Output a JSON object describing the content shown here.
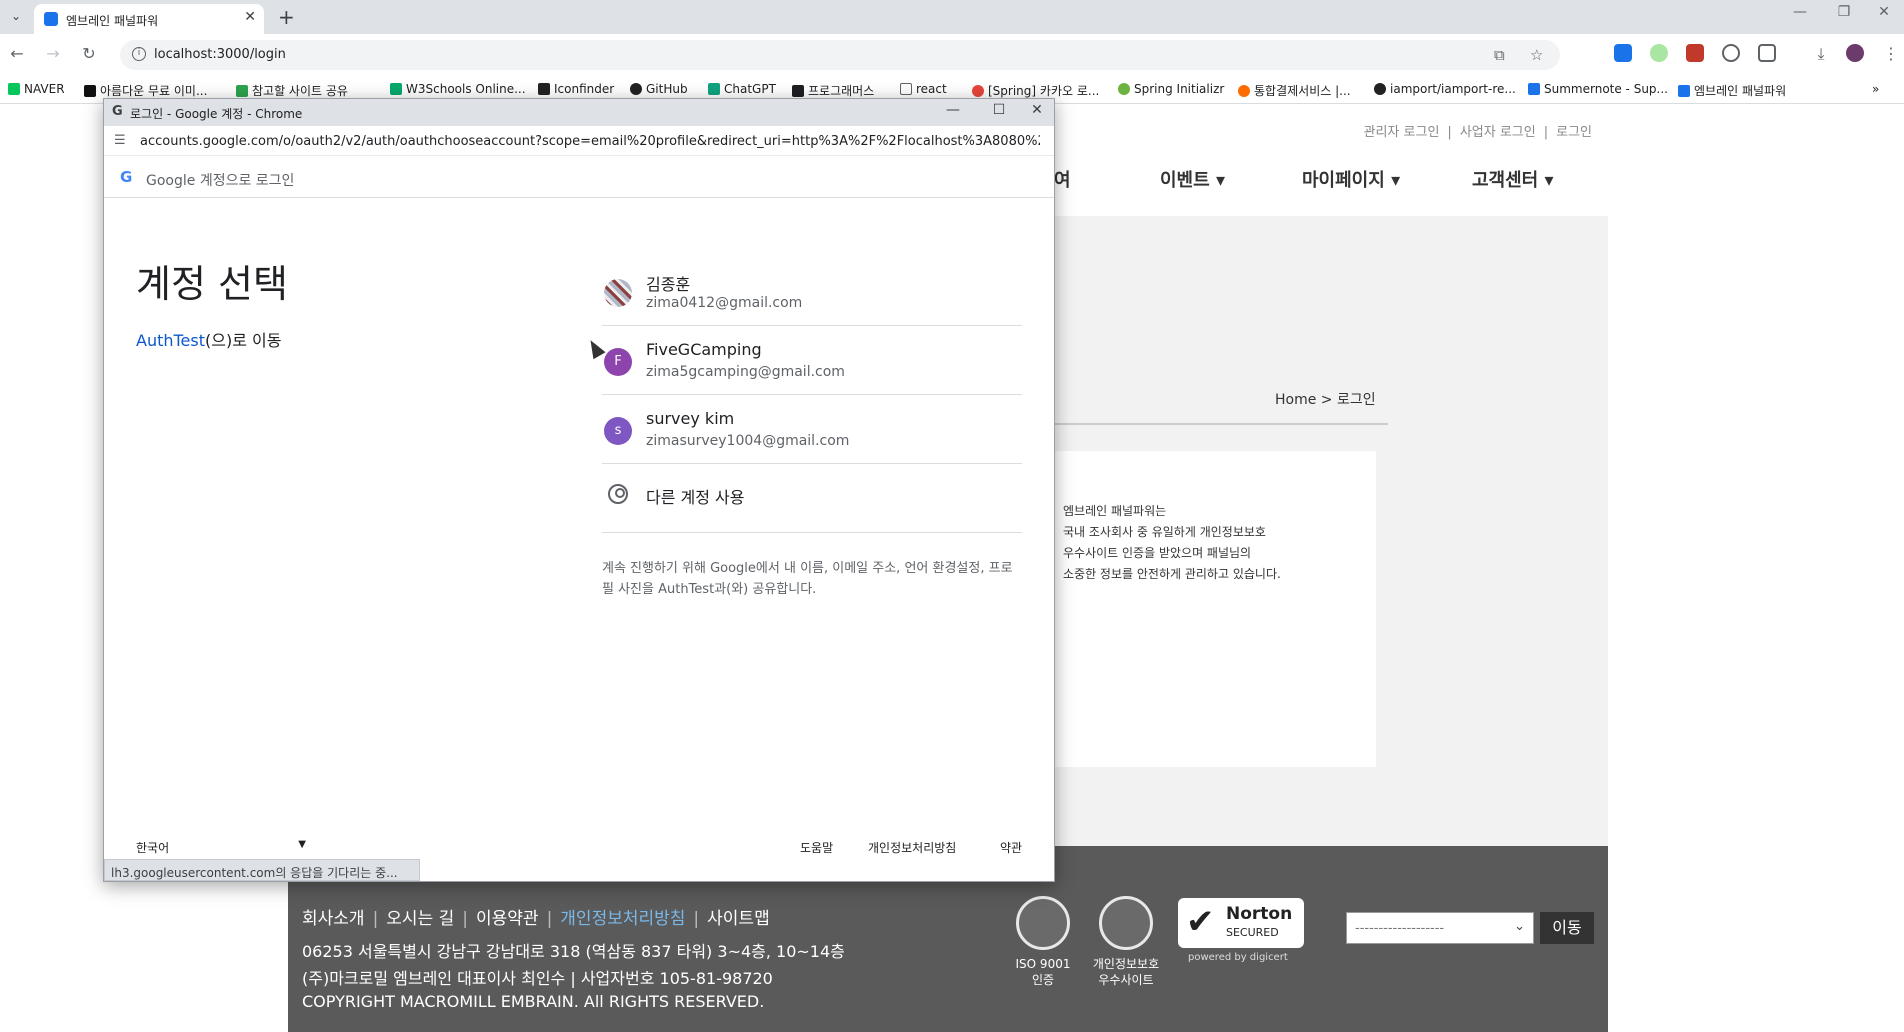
{
  "browser": {
    "tab_title": "엠브레인 패널파워",
    "tab_close": "✕",
    "new_tab": "+",
    "url": "localhost:3000/login",
    "window_controls": [
      "—",
      "❐",
      "✕"
    ],
    "bookmarks": [
      {
        "label": "NAVER",
        "color": "#03c75a"
      },
      {
        "label": "아름다운 무료 이미...",
        "color": "#111111"
      },
      {
        "label": "참고할 사이트 공유",
        "color": "#2da44e"
      },
      {
        "label": "W3Schools Online...",
        "color": "#04aa6d"
      },
      {
        "label": "Iconfinder",
        "color": "#222222"
      },
      {
        "label": "GitHub",
        "color": "#222222"
      },
      {
        "label": "ChatGPT",
        "color": "#10a37f"
      },
      {
        "label": "프로그래머스",
        "color": "#1e1e23"
      },
      {
        "label": "react",
        "color": "#5f6368"
      },
      {
        "label": "[Spring] 카카오 로...",
        "color": "#e8453c"
      },
      {
        "label": "Spring Initializr",
        "color": "#6db33f"
      },
      {
        "label": "통합결제서비스 |...",
        "color": "#ff6b00"
      },
      {
        "label": "iamport/iamport-re...",
        "color": "#222222"
      },
      {
        "label": "Summernote - Sup...",
        "color": "#1a73e8"
      },
      {
        "label": "엠브레인 패널파워",
        "color": "#1a73e8"
      }
    ],
    "more_bookmarks": "»"
  },
  "page": {
    "top_links": [
      "관리자 로그인",
      "|",
      "사업자 로그인",
      "|",
      "로그인"
    ],
    "nav": [
      "여",
      "이벤트 ▾",
      "마이페이지 ▾",
      "고객센터 ▾"
    ],
    "breadcrumb": "Home  >  로그인",
    "login_desc": [
      "엠브레인 패널파워는",
      "국내 조사회사 중 유일하게 개인정보보호",
      "우수사이트 인증을 받았으며 패널님의",
      "소중한 정보를 안전하게 관리하고 있습니다."
    ],
    "footer": {
      "links": [
        "회사소개",
        "오시는 길",
        "이용약관",
        "개인정보처리방침",
        "사이트맵"
      ],
      "address": "06253 서울특별시 강남구 강남대로 318 (역삼동 837 타워) 3~4층, 10~14층",
      "company": "(주)마크로밀 엠브레인 대표이사 최인수   |   사업자번호 105-81-98720",
      "copyright": "COPYRIGHT MACROMILL EMBRAIN. All RIGHTS RESERVED.",
      "badge_iso": [
        "ISO 9001",
        "인증"
      ],
      "badge_privacy": [
        "개인정보보호",
        "우수사이트"
      ],
      "norton_title": "Norton",
      "norton_sub": "SECURED",
      "norton_powered": "powered by digicert",
      "select_placeholder": "-------------------",
      "go_button": "이동"
    }
  },
  "popup": {
    "title": "로그인 - Google 계정 - Chrome",
    "url": "accounts.google.com/o/oauth2/v2/auth/oauthchooseaccount?scope=email%20profile&redirect_uri=http%3A%2F%2Flocalhost%3A8080%2F...",
    "gbar_text": "Google 계정으로 로그인",
    "heading": "계정 선택",
    "continue_app": "AuthTest",
    "continue_suffix": "(으)로 이동",
    "accounts": [
      {
        "name": "김종훈",
        "email": "zima0412@gmail.com",
        "initial": "",
        "color": "#9e9e9e"
      },
      {
        "name": "FiveGCamping",
        "email": "zima5gcamping@gmail.com",
        "initial": "F",
        "color": "#8e44ad"
      },
      {
        "name": "survey kim",
        "email": "zimasurvey1004@gmail.com",
        "initial": "s",
        "color": "#7e57c2"
      }
    ],
    "other_account": "다른 계정 사용",
    "share_note": "계속 진행하기 위해 Google에서 내 이름, 이메일 주소, 언어 환경설정, 프로필 사진을 AuthTest과(와) 공유합니다.",
    "language": "한국어",
    "footer_links": [
      "도움말",
      "개인정보처리방침",
      "약관"
    ],
    "status": "lh3.googleusercontent.com의 응답을 기다리는 중..."
  }
}
